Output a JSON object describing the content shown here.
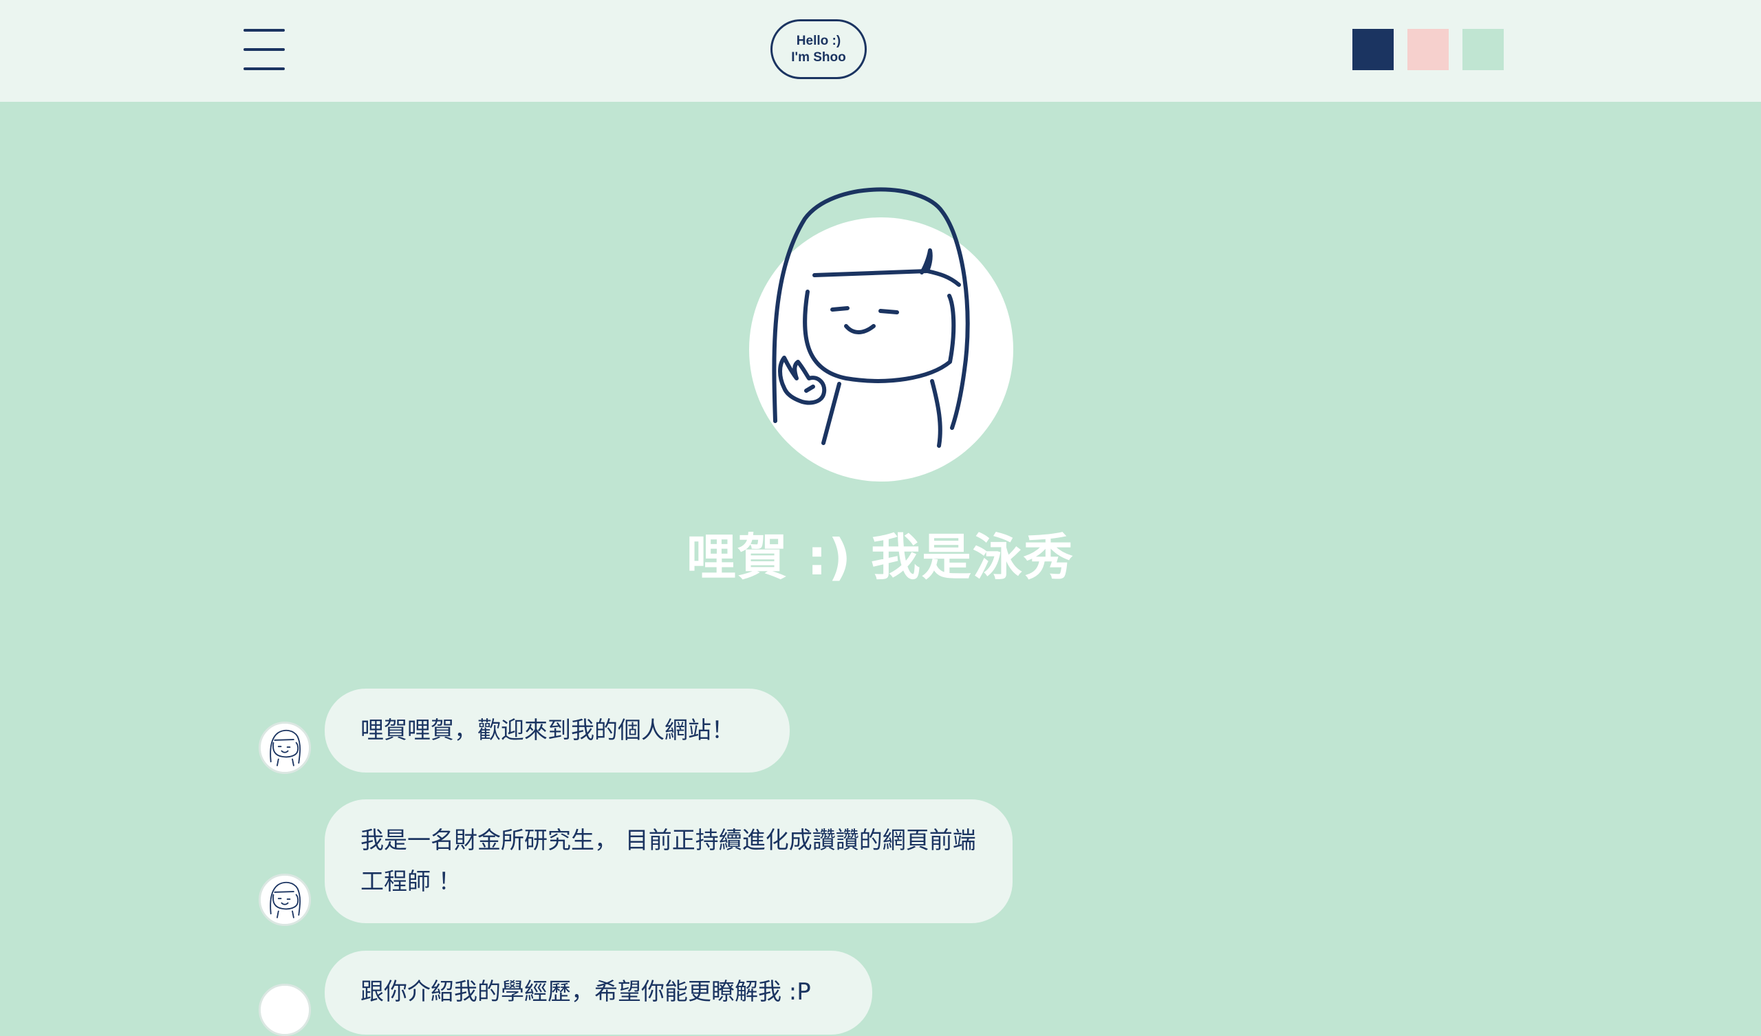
{
  "header": {
    "menu_icon": "hamburger-menu-icon",
    "logo_line1": "Hello :)",
    "logo_line2": "I'm Shoo",
    "theme_swatches": [
      "#1b3461",
      "#f6d0cd",
      "#c0e5d2"
    ]
  },
  "hero": {
    "avatar_icon": "girl-peace-sign-illustration",
    "title": "哩賀 :) 我是泳秀"
  },
  "chat": {
    "messages": [
      "哩賀哩賀，歡迎來到我的個人網站！",
      "我是一名財金所研究生， 目前正持續進化成讚讚的網頁前端工程師 ！",
      "跟你介紹我的學經歷，希望你能更瞭解我 :P"
    ]
  },
  "colors": {
    "primary": "#1b3461",
    "pink": "#f6d0cd",
    "mint": "#c0e5d2",
    "header_bg": "#ebf5f0",
    "bubble_bg": "#ebf5f0"
  }
}
